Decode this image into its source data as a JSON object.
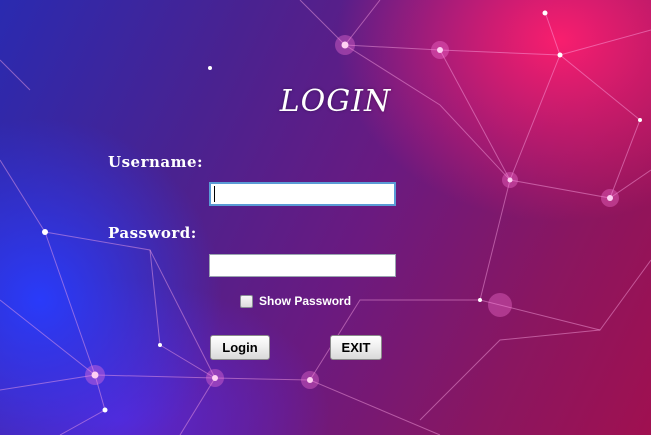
{
  "login_form": {
    "title": "LOGIN",
    "username_label": "Username:",
    "username_value": "",
    "password_label": "Password:",
    "password_value": "",
    "show_password_label": "Show Password",
    "show_password_checked": false,
    "login_button": "Login",
    "exit_button": "EXIT"
  },
  "colors": {
    "background_pink": "#ff1e6e",
    "background_blue": "#283cff",
    "background_purple": "#4b1a7a",
    "text": "#ffffff",
    "focus_border": "#5a9bd5"
  }
}
